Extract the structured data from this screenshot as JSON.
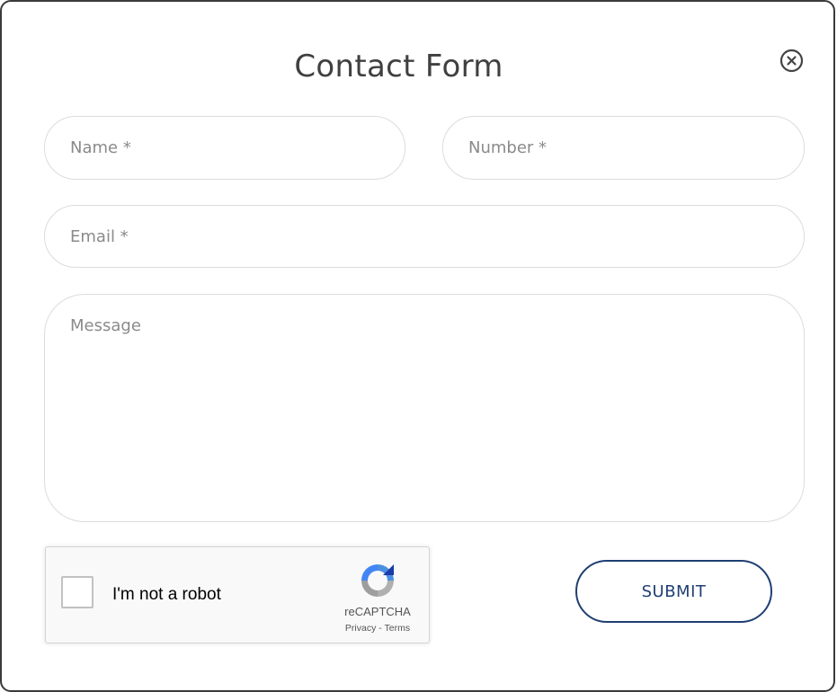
{
  "form": {
    "title": "Contact Form",
    "name_placeholder": "Name *",
    "number_placeholder": "Number *",
    "email_placeholder": "Email *",
    "message_placeholder": "Message",
    "submit_label": "SUBMIT"
  },
  "recaptcha": {
    "label": "I'm not a robot",
    "brand": "reCAPTCHA",
    "privacy": "Privacy",
    "separator": " - ",
    "terms": "Terms"
  },
  "icons": {
    "close": "close-circle-icon",
    "recaptcha_logo": "recaptcha-logo-icon"
  },
  "colors": {
    "accent": "#1f3f73",
    "border": "#dcdcdc",
    "title": "#404040"
  }
}
